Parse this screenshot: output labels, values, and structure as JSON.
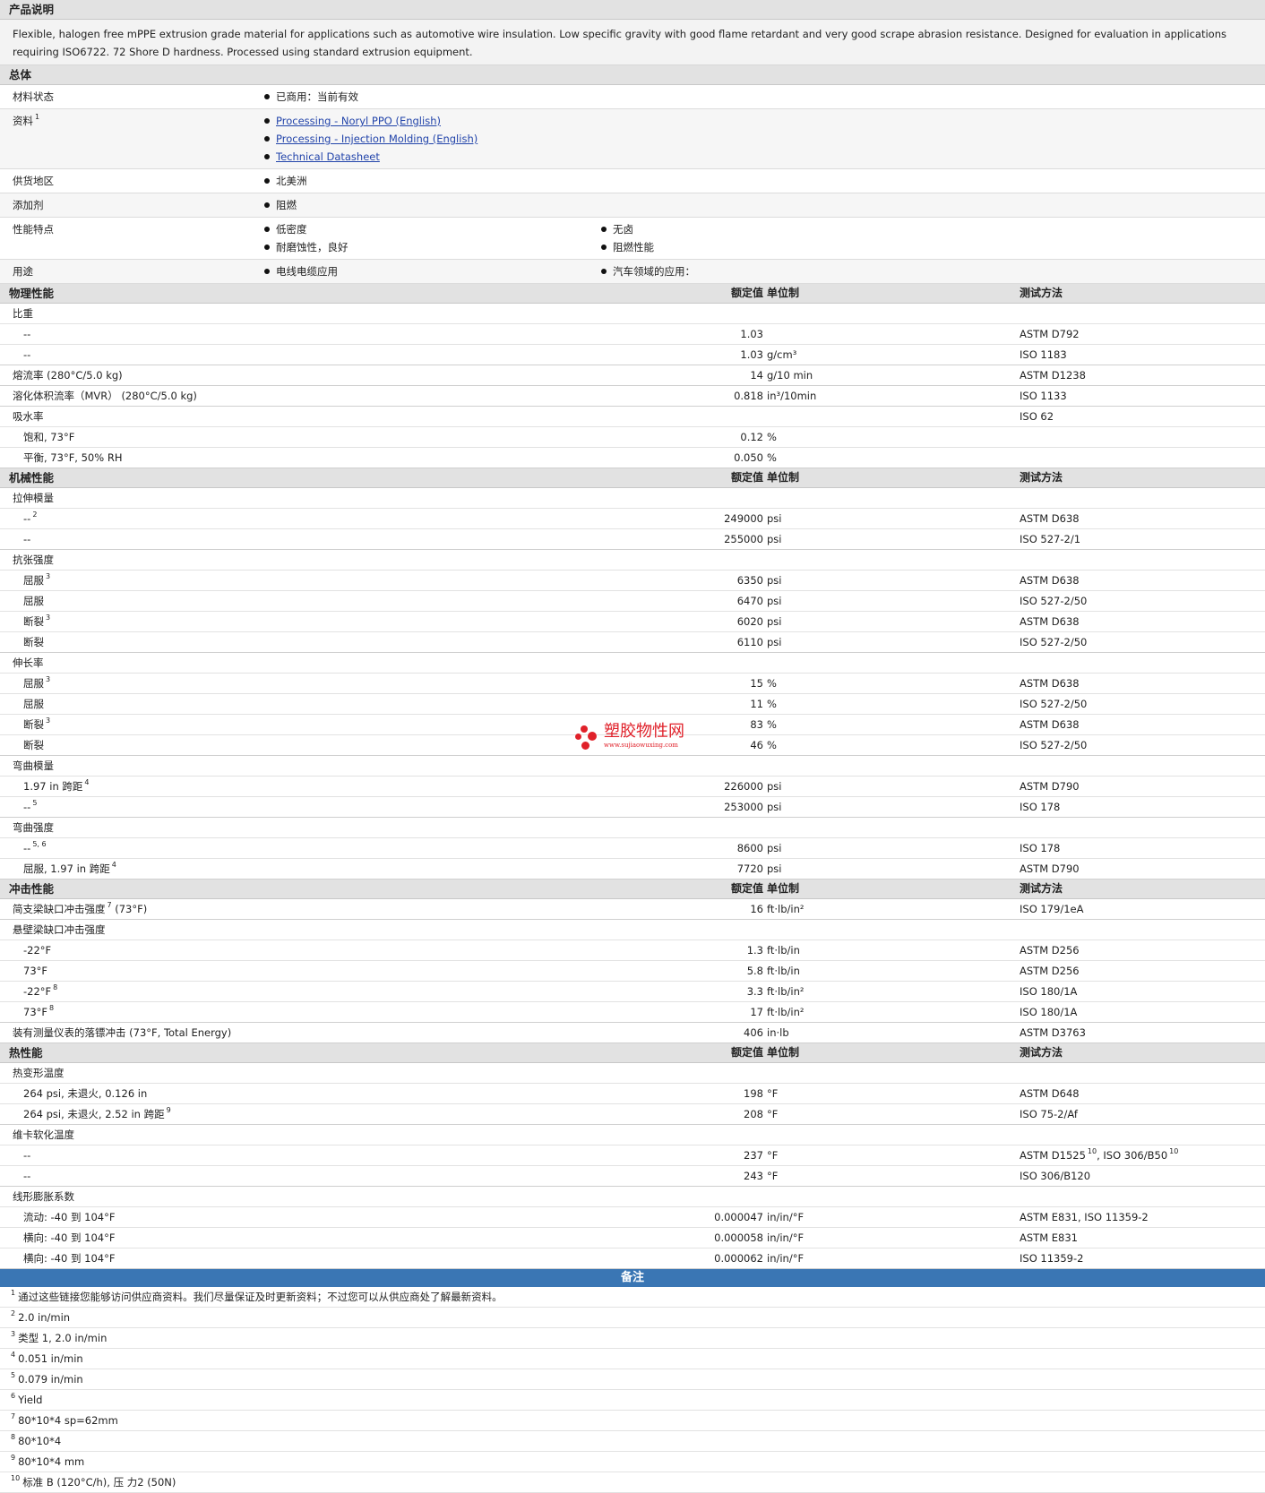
{
  "desc_title": "产品说明",
  "desc_text": "Flexible, halogen free mPPE extrusion grade material for applications such as automotive wire insulation. Low specific gravity with good flame retardant and very good scrape abrasion resistance. Designed for evaluation in applications requiring ISO6722. 72 Shore D hardness. Processed using standard extrusion equipment.",
  "general_title": "总体",
  "general": [
    {
      "label": "材料状态",
      "sup": "",
      "full": true,
      "items": [
        "已商用：当前有效"
      ],
      "links": false
    },
    {
      "label": "资料",
      "sup": "1",
      "full": true,
      "items": [
        "Processing - Noryl PPO (English)",
        "Processing - Injection Molding (English)",
        "Technical Datasheet"
      ],
      "links": true
    },
    {
      "label": "供货地区",
      "sup": "",
      "full": false,
      "items": [
        "北美洲"
      ],
      "links": false
    },
    {
      "label": "添加剂",
      "sup": "",
      "full": false,
      "items": [
        "阻燃"
      ],
      "links": false
    },
    {
      "label": "性能特点",
      "sup": "",
      "full": false,
      "items": [
        "低密度",
        "无卤",
        "耐磨蚀性，良好",
        "阻燃性能"
      ],
      "links": false
    },
    {
      "label": "用途",
      "sup": "",
      "full": false,
      "items": [
        "电线电缆应用",
        "汽车领域的应用："
      ],
      "links": false
    }
  ],
  "hdr_value": "额定值",
  "hdr_unit": "单位制",
  "hdr_method": "测试方法",
  "sections": [
    {
      "title": "物理性能",
      "rows": [
        {
          "l": "比重",
          "s": "",
          "c": "",
          "v": "",
          "u": "",
          "m": "",
          "i": false,
          "g": false
        },
        {
          "l": "--",
          "s": "",
          "c": "",
          "v": "1.03",
          "u": "",
          "m": "ASTM D792",
          "i": true,
          "g": false
        },
        {
          "l": "--",
          "s": "",
          "c": "",
          "v": "1.03",
          "u": "g/cm³",
          "m": "ISO 1183",
          "i": true,
          "g": true
        },
        {
          "l": "熔流率",
          "s": "",
          "c": "(280°C/5.0 kg)",
          "v": "14",
          "u": "g/10 min",
          "m": "ASTM D1238",
          "i": false,
          "g": true
        },
        {
          "l": "溶化体积流率（MVR）",
          "s": "",
          "c": "(280°C/5.0 kg)",
          "v": "0.818",
          "u": "in³/10min",
          "m": "ISO 1133",
          "i": false,
          "g": true
        },
        {
          "l": "吸水率",
          "s": "",
          "c": "",
          "v": "",
          "u": "",
          "m": "ISO 62",
          "i": false,
          "g": false
        },
        {
          "l": "饱和, 73°F",
          "s": "",
          "c": "",
          "v": "0.12",
          "u": "%",
          "m": "",
          "i": true,
          "g": false
        },
        {
          "l": "平衡, 73°F, 50% RH",
          "s": "",
          "c": "",
          "v": "0.050",
          "u": "%",
          "m": "",
          "i": true,
          "g": true
        }
      ]
    },
    {
      "title": "机械性能",
      "rows": [
        {
          "l": "拉伸模量",
          "s": "",
          "c": "",
          "v": "",
          "u": "",
          "m": "",
          "i": false,
          "g": false
        },
        {
          "l": "--",
          "s": "2",
          "c": "",
          "v": "249000",
          "u": "psi",
          "m": "ASTM D638",
          "i": true,
          "g": false
        },
        {
          "l": "--",
          "s": "",
          "c": "",
          "v": "255000",
          "u": "psi",
          "m": "ISO 527-2/1",
          "i": true,
          "g": true
        },
        {
          "l": "抗张强度",
          "s": "",
          "c": "",
          "v": "",
          "u": "",
          "m": "",
          "i": false,
          "g": false
        },
        {
          "l": "屈服",
          "s": "3",
          "c": "",
          "v": "6350",
          "u": "psi",
          "m": "ASTM D638",
          "i": true,
          "g": false
        },
        {
          "l": "屈服",
          "s": "",
          "c": "",
          "v": "6470",
          "u": "psi",
          "m": "ISO 527-2/50",
          "i": true,
          "g": false
        },
        {
          "l": "断裂",
          "s": "3",
          "c": "",
          "v": "6020",
          "u": "psi",
          "m": "ASTM D638",
          "i": true,
          "g": false
        },
        {
          "l": "断裂",
          "s": "",
          "c": "",
          "v": "6110",
          "u": "psi",
          "m": "ISO 527-2/50",
          "i": true,
          "g": true
        },
        {
          "l": "伸长率",
          "s": "",
          "c": "",
          "v": "",
          "u": "",
          "m": "",
          "i": false,
          "g": false
        },
        {
          "l": "屈服",
          "s": "3",
          "c": "",
          "v": "15",
          "u": "%",
          "m": "ASTM D638",
          "i": true,
          "g": false
        },
        {
          "l": "屈服",
          "s": "",
          "c": "",
          "v": "11",
          "u": "%",
          "m": "ISO 527-2/50",
          "i": true,
          "g": false
        },
        {
          "l": "断裂",
          "s": "3",
          "c": "",
          "v": "83",
          "u": "%",
          "m": "ASTM D638",
          "i": true,
          "g": false
        },
        {
          "l": "断裂",
          "s": "",
          "c": "",
          "v": "46",
          "u": "%",
          "m": "ISO 527-2/50",
          "i": true,
          "g": true
        },
        {
          "l": "弯曲模量",
          "s": "",
          "c": "",
          "v": "",
          "u": "",
          "m": "",
          "i": false,
          "g": false
        },
        {
          "l": "1.97 in 跨距",
          "s": "4",
          "c": "",
          "v": "226000",
          "u": "psi",
          "m": "ASTM D790",
          "i": true,
          "g": false
        },
        {
          "l": "--",
          "s": "5",
          "c": "",
          "v": "253000",
          "u": "psi",
          "m": "ISO 178",
          "i": true,
          "g": true
        },
        {
          "l": "弯曲强度",
          "s": "",
          "c": "",
          "v": "",
          "u": "",
          "m": "",
          "i": false,
          "g": false
        },
        {
          "l": "--",
          "s": "5, 6",
          "c": "",
          "v": "8600",
          "u": "psi",
          "m": "ISO 178",
          "i": true,
          "g": false
        },
        {
          "l": "屈服, 1.97 in 跨距",
          "s": "4",
          "c": "",
          "v": "7720",
          "u": "psi",
          "m": "ASTM D790",
          "i": true,
          "g": true
        }
      ]
    },
    {
      "title": "冲击性能",
      "rows": [
        {
          "l": "简支梁缺口冲击强度",
          "s": "7",
          "c": "(73°F)",
          "v": "16",
          "u": "ft·lb/in²",
          "m": "ISO 179/1eA",
          "i": false,
          "g": true
        },
        {
          "l": "悬壁梁缺口冲击强度",
          "s": "",
          "c": "",
          "v": "",
          "u": "",
          "m": "",
          "i": false,
          "g": false
        },
        {
          "l": "-22°F",
          "s": "",
          "c": "",
          "v": "1.3",
          "u": "ft·lb/in",
          "m": "ASTM D256",
          "i": true,
          "g": false
        },
        {
          "l": "73°F",
          "s": "",
          "c": "",
          "v": "5.8",
          "u": "ft·lb/in",
          "m": "ASTM D256",
          "i": true,
          "g": false
        },
        {
          "l": "-22°F",
          "s": "8",
          "c": "",
          "v": "3.3",
          "u": "ft·lb/in²",
          "m": "ISO 180/1A",
          "i": true,
          "g": false
        },
        {
          "l": "73°F",
          "s": "8",
          "c": "",
          "v": "17",
          "u": "ft·lb/in²",
          "m": "ISO 180/1A",
          "i": true,
          "g": true
        },
        {
          "l": "装有测量仪表的落镖冲击",
          "s": "",
          "c": "(73°F, Total Energy)",
          "v": "406",
          "u": "in·lb",
          "m": "ASTM D3763",
          "i": false,
          "g": true
        }
      ]
    },
    {
      "title": "热性能",
      "rows": [
        {
          "l": "热变形温度",
          "s": "",
          "c": "",
          "v": "",
          "u": "",
          "m": "",
          "i": false,
          "g": false
        },
        {
          "l": "264 psi, 未退火, 0.126 in",
          "s": "",
          "c": "",
          "v": "198",
          "u": "°F",
          "m": "ASTM D648",
          "i": true,
          "g": false
        },
        {
          "l": "264 psi, 未退火, 2.52 in 跨距",
          "s": "9",
          "c": "",
          "v": "208",
          "u": "°F",
          "m": "ISO 75-2/Af",
          "i": true,
          "g": true
        },
        {
          "l": "维卡软化温度",
          "s": "",
          "c": "",
          "v": "",
          "u": "",
          "m": "",
          "i": false,
          "g": false
        },
        {
          "l": "--",
          "s": "",
          "c": "",
          "v": "237",
          "u": "°F",
          "m": "ASTM D1525",
          "ms": "10",
          "m2": ", ISO 306/B50",
          "ms2": "10",
          "i": true,
          "g": false
        },
        {
          "l": "--",
          "s": "",
          "c": "",
          "v": "243",
          "u": "°F",
          "m": "ISO 306/B120",
          "i": true,
          "g": true
        },
        {
          "l": "线形膨胀系数",
          "s": "",
          "c": "",
          "v": "",
          "u": "",
          "m": "",
          "i": false,
          "g": false
        },
        {
          "l": "流动: -40 到 104°F",
          "s": "",
          "c": "",
          "v": "0.000047",
          "u": "in/in/°F",
          "m": "ASTM E831, ISO 11359-2",
          "i": true,
          "g": false
        },
        {
          "l": "横向: -40 到 104°F",
          "s": "",
          "c": "",
          "v": "0.000058",
          "u": "in/in/°F",
          "m": "ASTM E831",
          "i": true,
          "g": false
        },
        {
          "l": "横向: -40 到 104°F",
          "s": "",
          "c": "",
          "v": "0.000062",
          "u": "in/in/°F",
          "m": "ISO 11359-2",
          "i": true,
          "g": true
        }
      ]
    }
  ],
  "notes_title": "备注",
  "notes": [
    {
      "n": "1",
      "t": "通过这些链接您能够访问供应商资料。我们尽量保证及时更新资料；不过您可以从供应商处了解最新资料。"
    },
    {
      "n": "2",
      "t": "2.0 in/min"
    },
    {
      "n": "3",
      "t": "类型  1, 2.0 in/min"
    },
    {
      "n": "4",
      "t": "0.051 in/min"
    },
    {
      "n": "5",
      "t": "0.079 in/min"
    },
    {
      "n": "6",
      "t": "Yield"
    },
    {
      "n": "7",
      "t": "80*10*4 sp=62mm"
    },
    {
      "n": "8",
      "t": "80*10*4"
    },
    {
      "n": "9",
      "t": "80*10*4 mm"
    },
    {
      "n": "10",
      "t": "标准  B (120°C/h), 压  力2 (50N)"
    }
  ],
  "watermark": {
    "cn": "塑胶物性网",
    "url": "www.sujiaowuxing.com",
    "color": "#e0212a"
  }
}
